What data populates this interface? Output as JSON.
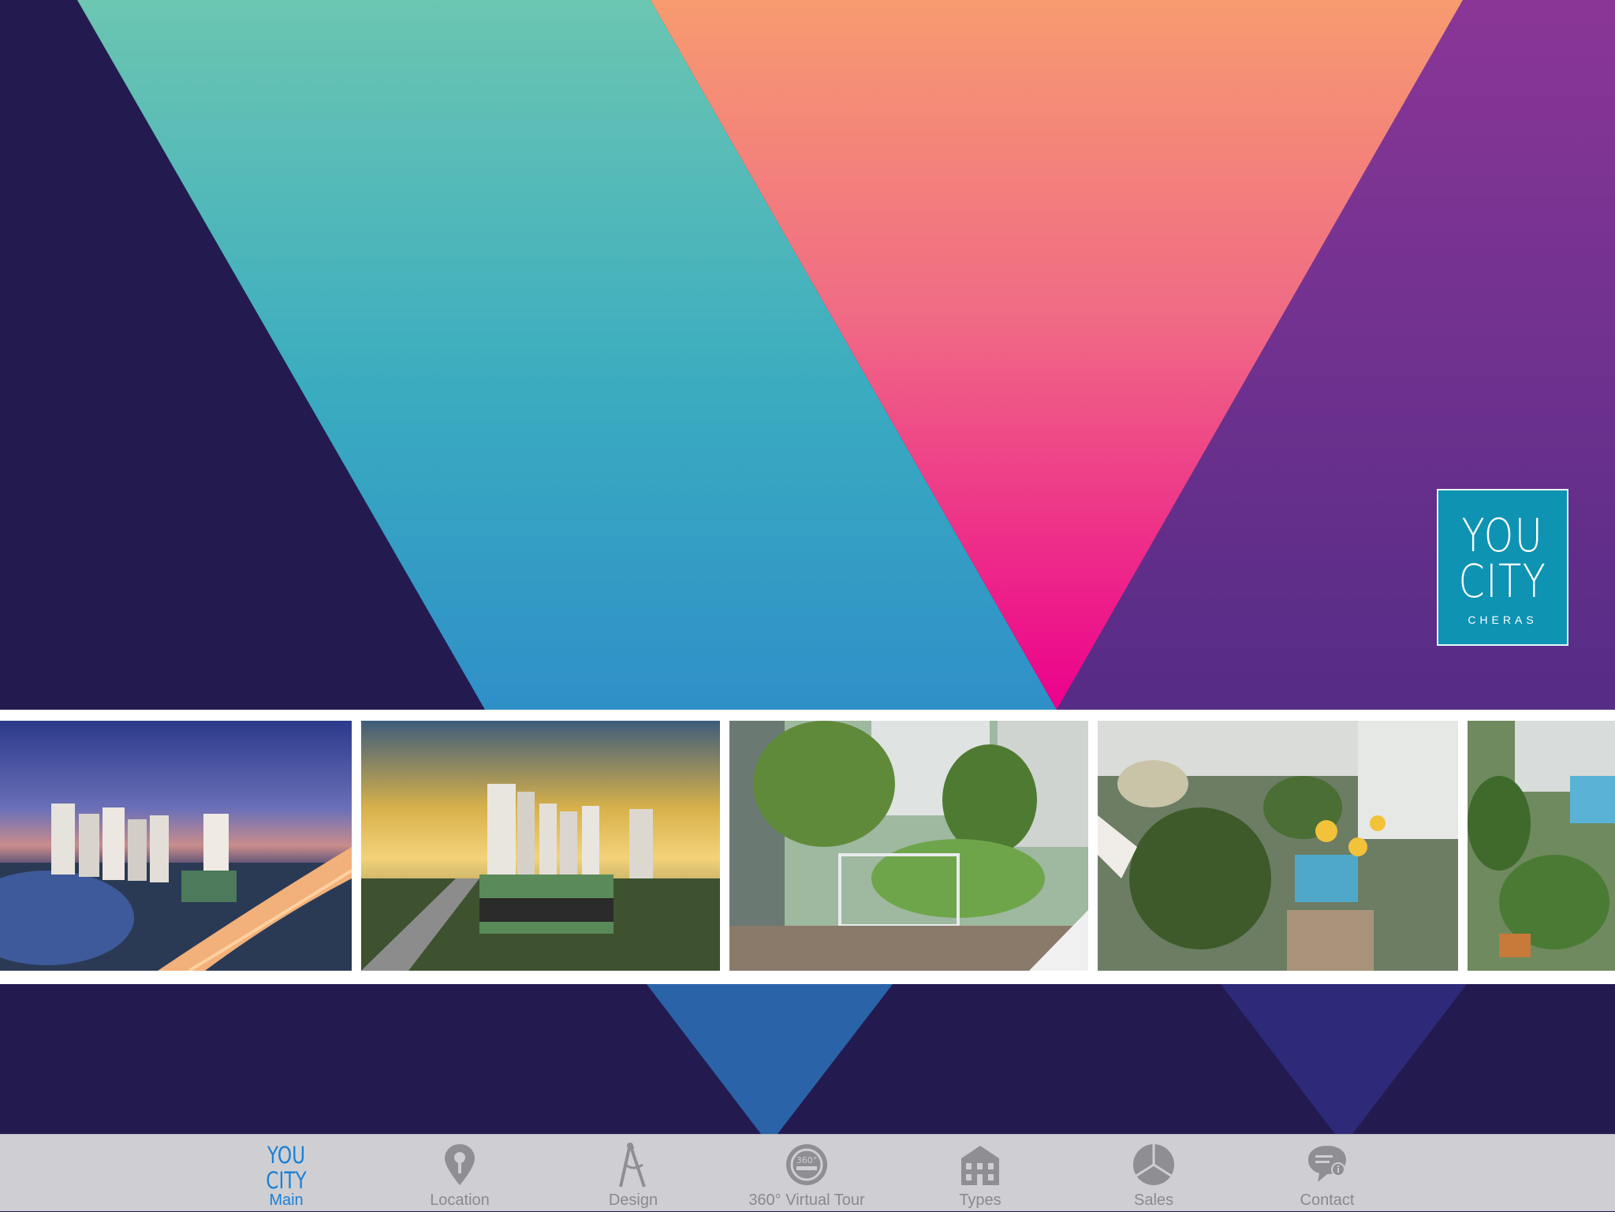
{
  "app": {
    "logo": {
      "line1": "YOU",
      "line2": "CITY",
      "line3": "CHERAS"
    },
    "colors": {
      "background": "#231b50",
      "teal_top": "#6cc6b1",
      "teal_bottom": "#2f97c6",
      "pink_top": "#f79b70",
      "pink_bottom": "#ec008c",
      "purple": "#7a3494",
      "logo_bg": "#0e93b3",
      "tab_active": "#1a7fd6",
      "tab_inactive": "#8a8a8e",
      "tabbar_bg": "#cfcfd3"
    }
  },
  "gallery": {
    "photos": [
      {
        "name": "night-aerial-view"
      },
      {
        "name": "sunset-towers-view"
      },
      {
        "name": "garden-courtyard"
      },
      {
        "name": "pool-garden-aerial"
      },
      {
        "name": "rooftop-garden-partial"
      }
    ]
  },
  "tabbar": {
    "items": [
      {
        "label": "Main",
        "icon": "youcity-logo-icon",
        "active": true
      },
      {
        "label": "Location",
        "icon": "map-pin-icon",
        "active": false
      },
      {
        "label": "Design",
        "icon": "compass-icon",
        "active": false
      },
      {
        "label": "360° Virtual Tour",
        "icon": "360-tour-icon",
        "active": false
      },
      {
        "label": "Types",
        "icon": "building-icon",
        "active": false
      },
      {
        "label": "Sales",
        "icon": "pie-chart-icon",
        "active": false
      },
      {
        "label": "Contact",
        "icon": "chat-bubble-icon",
        "active": false
      }
    ],
    "tab_logo": {
      "line1": "YOU",
      "line2": "CITY"
    }
  }
}
